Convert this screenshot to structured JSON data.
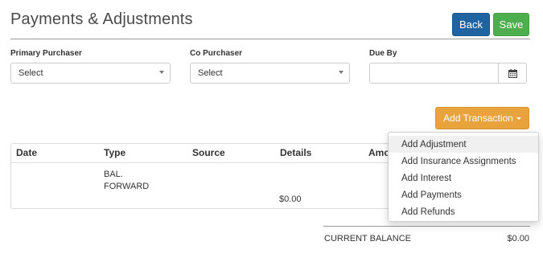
{
  "page": {
    "title": "Payments & Adjustments"
  },
  "header": {
    "back_label": "Back",
    "save_label": "Save"
  },
  "form": {
    "primary_purchaser": {
      "label": "Primary Purchaser",
      "value": "Select"
    },
    "co_purchaser": {
      "label": "Co Purchaser",
      "value": "Select"
    },
    "due_by": {
      "label": "Due By",
      "value": "",
      "icon": "calendar-icon"
    }
  },
  "actions": {
    "add_transaction_label": "Add Transaction"
  },
  "table": {
    "columns": [
      "Date",
      "Type",
      "Source",
      "Details",
      "Amo"
    ],
    "rows": [
      {
        "date": "",
        "type_line1": "BAL.",
        "type_line2": "FORWARD",
        "source": "",
        "details": "$0.00"
      }
    ]
  },
  "balance": {
    "label": "CURRENT BALANCE",
    "value": "$0.00"
  },
  "dropdown": {
    "items": [
      {
        "label": "Add Adjustment",
        "highlighted": true
      },
      {
        "label": "Add Insurance Assignments",
        "highlighted": false
      },
      {
        "label": "Add Interest",
        "highlighted": false
      },
      {
        "label": "Add Payments",
        "highlighted": false
      },
      {
        "label": "Add Refunds",
        "highlighted": false
      }
    ]
  },
  "colors": {
    "back": "#1f63a0",
    "save": "#4cae4c",
    "add_transaction": "#e8a33d"
  }
}
